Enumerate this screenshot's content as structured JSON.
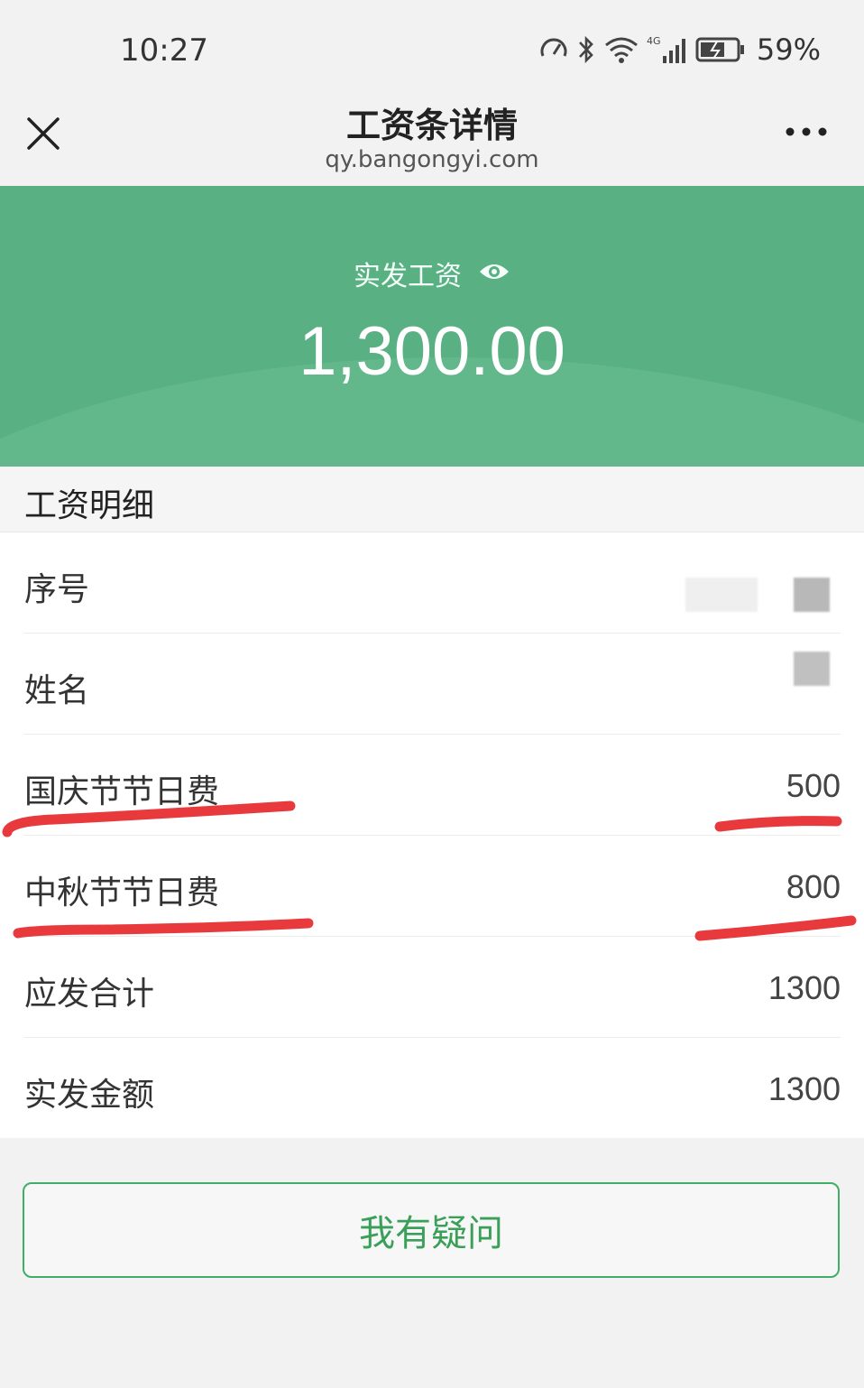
{
  "status_bar": {
    "time": "10:27",
    "battery_percent": "59%",
    "icons": [
      "speed-icon",
      "bluetooth-icon",
      "wifi-icon",
      "signal-4g-icon",
      "battery-charging-icon"
    ]
  },
  "nav": {
    "title": "工资条详情",
    "url": "qy.bangongyi.com",
    "close_icon": "close-icon",
    "more_icon": "more-icon"
  },
  "hero": {
    "label": "实发工资",
    "amount": "1,300.00",
    "eye_icon": "eye-icon",
    "background_color": "#58b083"
  },
  "section": {
    "title": "工资明细"
  },
  "details": [
    {
      "label": "序号",
      "value": ""
    },
    {
      "label": "姓名",
      "value": ""
    },
    {
      "label": "国庆节节日费",
      "value": "500"
    },
    {
      "label": "中秋节节日费",
      "value": "800"
    },
    {
      "label": "应发合计",
      "value": "1300"
    },
    {
      "label": "实发金额",
      "value": "1300"
    }
  ],
  "actions": {
    "question_button": "我有疑问",
    "accent_color": "#3fae67"
  },
  "annotations": {
    "underline_color": "#e8393d"
  }
}
